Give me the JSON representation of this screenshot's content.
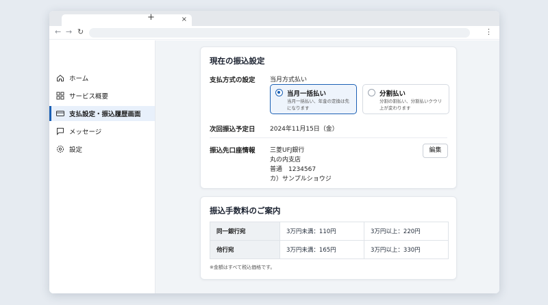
{
  "browser": {
    "tab_close": "×",
    "new_tab": "+",
    "back": "←",
    "forward": "→",
    "reload": "↻",
    "menu": "⋮"
  },
  "sidebar": {
    "items": [
      {
        "label": "ホーム",
        "icon": "home-icon"
      },
      {
        "label": "サービス概要",
        "icon": "grid-icon"
      },
      {
        "label": "支払設定・振込履歴画面",
        "icon": "card-icon",
        "active": true
      },
      {
        "label": "メッセージ",
        "icon": "chat-icon"
      },
      {
        "label": "設定",
        "icon": "gear-icon"
      }
    ]
  },
  "settings": {
    "title": "現在の振込設定",
    "payment_method_label": "支払方式の設定",
    "payment_method_value": "当月方式払い",
    "options": [
      {
        "title": "当月一括払い",
        "desc": "当月一括払い、年金の定換は先になります",
        "selected": true
      },
      {
        "title": "分割払い",
        "desc": "分割の割払い、分割払いクウリ上が変わります",
        "selected": false
      }
    ],
    "next_date_label": "次回振込予定日",
    "next_date_value": "2024年11月15日（金）",
    "account_label": "振込先口座情報",
    "account_lines": [
      "三菱UFJ銀行",
      "丸の内支店",
      "普通　1234567",
      "カ）サンプルショウジ"
    ],
    "edit_label": "編集"
  },
  "fees": {
    "title": "振込手数料のご案内",
    "rows": [
      {
        "head": "同一銀行宛",
        "under": "3万円未満：110円",
        "over": "3万円以上：220円"
      },
      {
        "head": "他行宛",
        "under": "3万円未満：165円",
        "over": "3万円以上：330円"
      }
    ],
    "note": "※金額はすべて税込価格です。"
  },
  "colors": {
    "accent": "#1a5fb4",
    "background": "#f1f4f7"
  }
}
